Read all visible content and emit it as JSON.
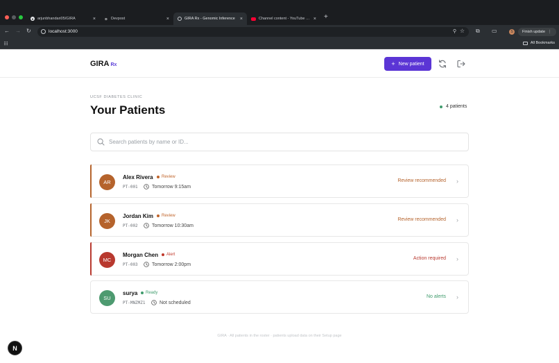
{
  "browser": {
    "tabs": [
      {
        "label": "arjunbhandari05/GIRA",
        "favicon": "github-icon",
        "active": false
      },
      {
        "label": "Devpost",
        "favicon": "devpost-icon",
        "active": false
      },
      {
        "label": "GIRA Rx - Genomic Inference",
        "favicon": "globe-icon",
        "active": true
      },
      {
        "label": "Channel content - YouTube Studio",
        "favicon": "youtube-icon",
        "active": false
      }
    ],
    "url": "localhost:3000",
    "finish_update": "Finish update",
    "profile_initial": "S",
    "all_bookmarks": "All Bookmarks"
  },
  "header": {
    "brand": "GIRA",
    "brand_suffix": "Rx",
    "new_patient": "New patient",
    "plus": "+"
  },
  "page": {
    "eyebrow": "UCSF DIABETES CLINIC",
    "title": "Your Patients",
    "count": "4 patients"
  },
  "search": {
    "placeholder": "Search patients by name or ID...",
    "value": ""
  },
  "patients": [
    {
      "initials": "AR",
      "name": "Alex Rivera",
      "badge": "Review",
      "id": "PT-001",
      "appointment": "Tomorrow 9:15am",
      "status": "Review recommended",
      "avatar_color": "#b5632c",
      "accent_color": "#b5632c",
      "badge_color": "#c0642a",
      "status_color": "#b5632c"
    },
    {
      "initials": "JK",
      "name": "Jordan Kim",
      "badge": "Review",
      "id": "PT-002",
      "appointment": "Tomorrow 10:30am",
      "status": "Review recommended",
      "avatar_color": "#b5632c",
      "accent_color": "#b5632c",
      "badge_color": "#c0642a",
      "status_color": "#b5632c"
    },
    {
      "initials": "MC",
      "name": "Morgan Chen",
      "badge": "Alert",
      "id": "PT-003",
      "appointment": "Tomorrow 2:00pm",
      "status": "Action required",
      "avatar_color": "#b8392f",
      "accent_color": "#b8392f",
      "badge_color": "#c0392b",
      "status_color": "#b8392f"
    },
    {
      "initials": "SU",
      "name": "surya",
      "badge": "Ready",
      "id": "PT-MNZMZ1",
      "appointment": "Not scheduled",
      "status": "No alerts",
      "avatar_color": "#4d9a70",
      "accent_color": "",
      "badge_color": "#3f9b6c",
      "status_color": "#3f9b6c"
    }
  ],
  "footer": {
    "text": "GIRA · All patients in the roster · patients upload data on their Setup page"
  },
  "dev_badge": "N",
  "colors": {
    "accent": "#5b35d5",
    "review": "#b5632c",
    "alert": "#b8392f",
    "ready": "#3f9b6c"
  }
}
